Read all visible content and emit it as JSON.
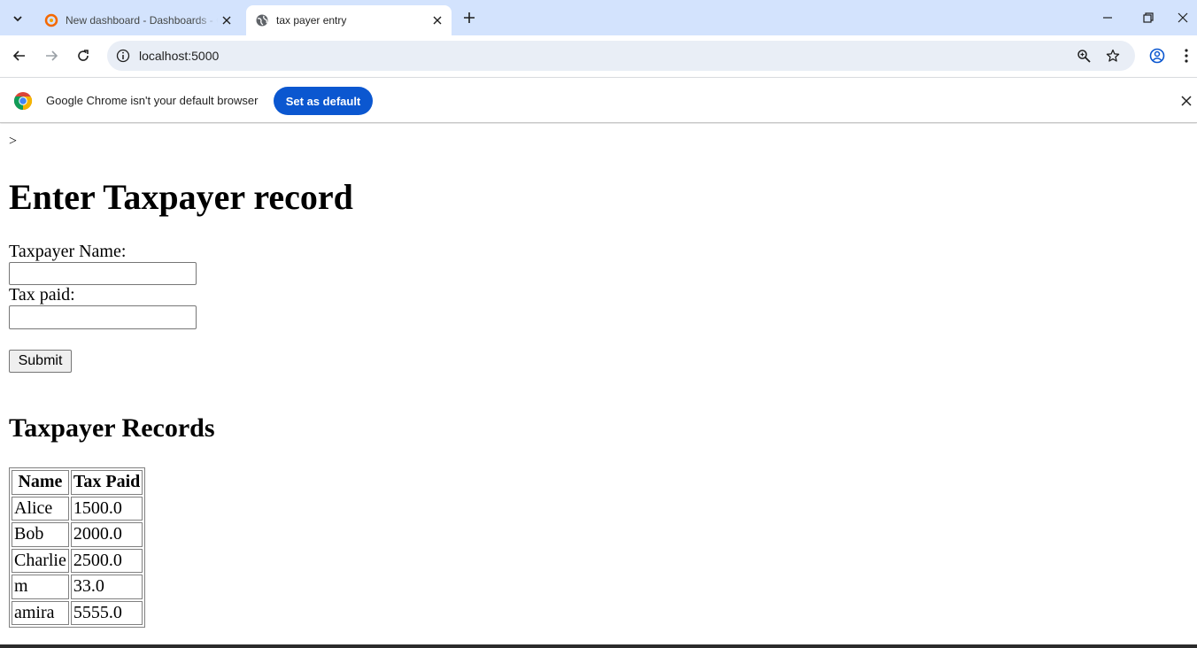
{
  "browser": {
    "tabs": [
      {
        "title": "New dashboard - Dashboards - Grafana",
        "active": false,
        "icon": "grafana-icon"
      },
      {
        "title": "tax payer entry",
        "active": true,
        "icon": "globe-icon"
      }
    ],
    "url": "localhost:5000",
    "infobar": {
      "message": "Google Chrome isn't your default browser",
      "button_label": "Set as default"
    }
  },
  "page": {
    "stray_text": ">",
    "heading": "Enter Taxpayer record",
    "form": {
      "name_label": "Taxpayer Name:",
      "name_value": "",
      "tax_label": "Tax paid:",
      "tax_value": "",
      "submit_label": "Submit"
    },
    "records_heading": "Taxpayer Records",
    "table": {
      "headers": [
        "Name",
        "Tax Paid"
      ],
      "rows": [
        [
          "Alice",
          "1500.0"
        ],
        [
          "Bob",
          "2000.0"
        ],
        [
          "Charlie",
          "2500.0"
        ],
        [
          "m",
          "33.0"
        ],
        [
          "amira",
          "5555.0"
        ]
      ]
    }
  },
  "colors": {
    "tabstrip": "#d3e3fd",
    "omnibox": "#e9eef6",
    "primary_button": "#0b57d0"
  }
}
